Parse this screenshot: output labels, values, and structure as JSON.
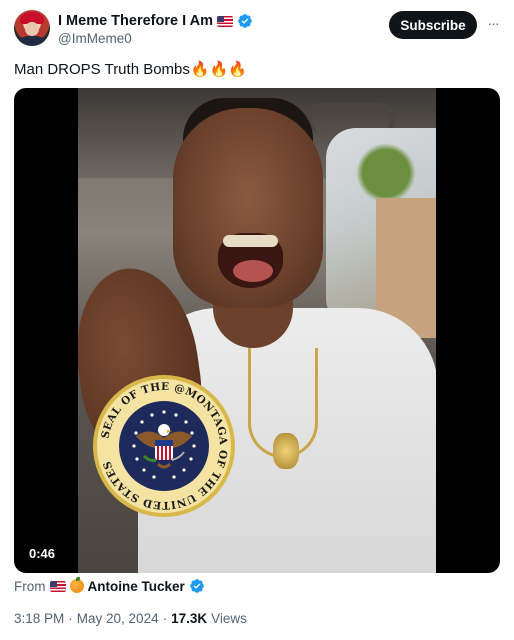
{
  "account": {
    "display_name": "I Meme Therefore I Am",
    "handle": "@ImMeme0"
  },
  "actions": {
    "subscribe_label": "Subscribe",
    "more_label": "···"
  },
  "tweet": {
    "text": "Man DROPS Truth Bombs",
    "emoji": "🔥🔥🔥"
  },
  "media": {
    "duration": "0:46",
    "seal_ring_text": "SEAL OF THE @MONTAGA OF THE UNITED STATES"
  },
  "source": {
    "from_label": "From",
    "name": "Antoine Tucker"
  },
  "meta": {
    "time": "3:18 PM",
    "date": "May 20, 2024",
    "views_count": "17.3K",
    "views_label": "Views",
    "separator": "·"
  },
  "colors": {
    "text_primary": "#0f1419",
    "text_secondary": "#536471",
    "verified_blue": "#1d9bf0",
    "button_dark": "#0f1419"
  },
  "icons": {
    "verified": "verified-badge-icon",
    "flag": "us-flag-icon",
    "orange": "orange-emoji-icon",
    "more": "more-dots-icon"
  }
}
